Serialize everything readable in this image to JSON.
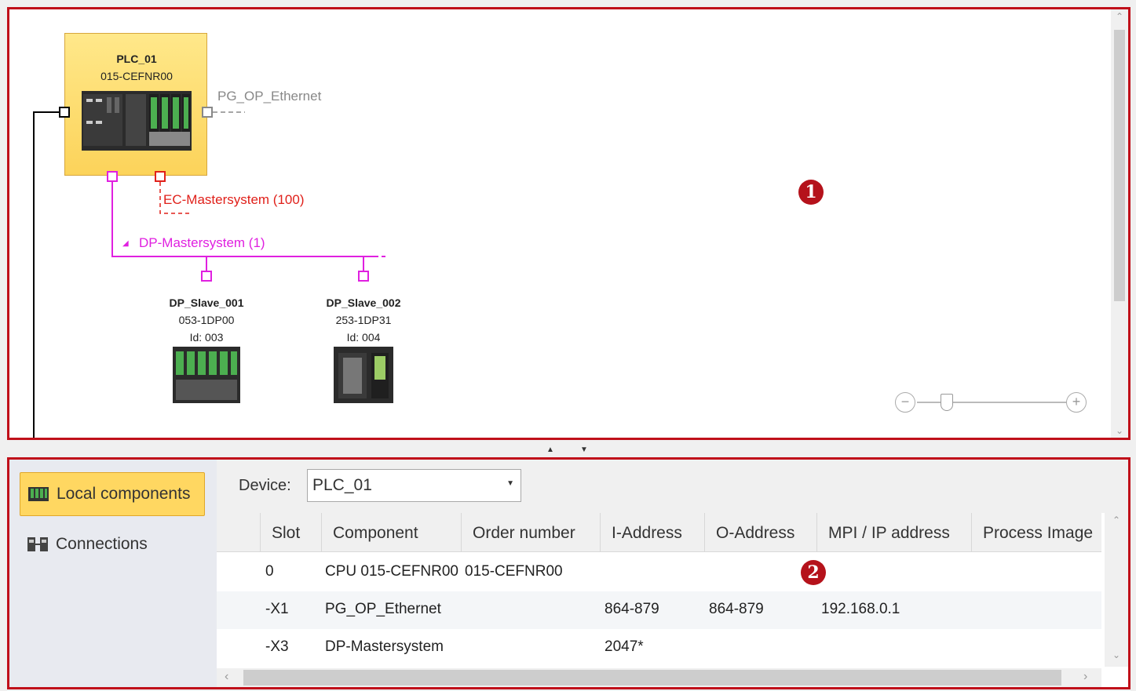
{
  "network_view": {
    "plc": {
      "name": "PLC_01",
      "order": "015-CEFNR00"
    },
    "pg_op_label": "PG_OP_Ethernet",
    "ec_label": "EC-Mastersystem (100)",
    "dp_label": "DP-Mastersystem (1)",
    "dp_collapse_glyph": "◢",
    "slaves": [
      {
        "name": "DP_Slave_001",
        "order": "053-1DP00",
        "id": "Id: 003"
      },
      {
        "name": "DP_Slave_002",
        "order": "253-1DP31",
        "id": "Id: 004"
      }
    ],
    "badge": "1",
    "zoom": {
      "minus": "−",
      "plus": "+",
      "level": 0.2
    },
    "colors": {
      "ethernet": "#888888",
      "ec": "#e0201a",
      "dp": "#e020e0",
      "mpi": "#000000",
      "badge": "#b5121b"
    }
  },
  "splitter": {
    "up": "▲",
    "down": "▼"
  },
  "bottom": {
    "badge": "2",
    "side_buttons": [
      {
        "label": "Local components",
        "icon": "local-components-icon",
        "active": true
      },
      {
        "label": "Connections",
        "icon": "connections-icon",
        "active": false
      }
    ],
    "device_label": "Device:",
    "device_value": "PLC_01",
    "columns": [
      "Slot",
      "Component",
      "Order number",
      "I-Address",
      "O-Address",
      "MPI / IP address",
      "Process Image"
    ],
    "rows": [
      {
        "slot": "0",
        "component": "CPU 015-CEFNR00",
        "order": "015-CEFNR00",
        "i_addr": "",
        "o_addr": "",
        "ip": "",
        "pi": ""
      },
      {
        "slot": "-X1",
        "component": "PG_OP_Ethernet",
        "order": "",
        "i_addr": "864-879",
        "o_addr": "864-879",
        "ip": "192.168.0.1",
        "pi": ""
      },
      {
        "slot": "-X3",
        "component": "DP-Mastersystem",
        "order": "",
        "i_addr": "2047*",
        "o_addr": "",
        "ip": "",
        "pi": ""
      }
    ]
  }
}
